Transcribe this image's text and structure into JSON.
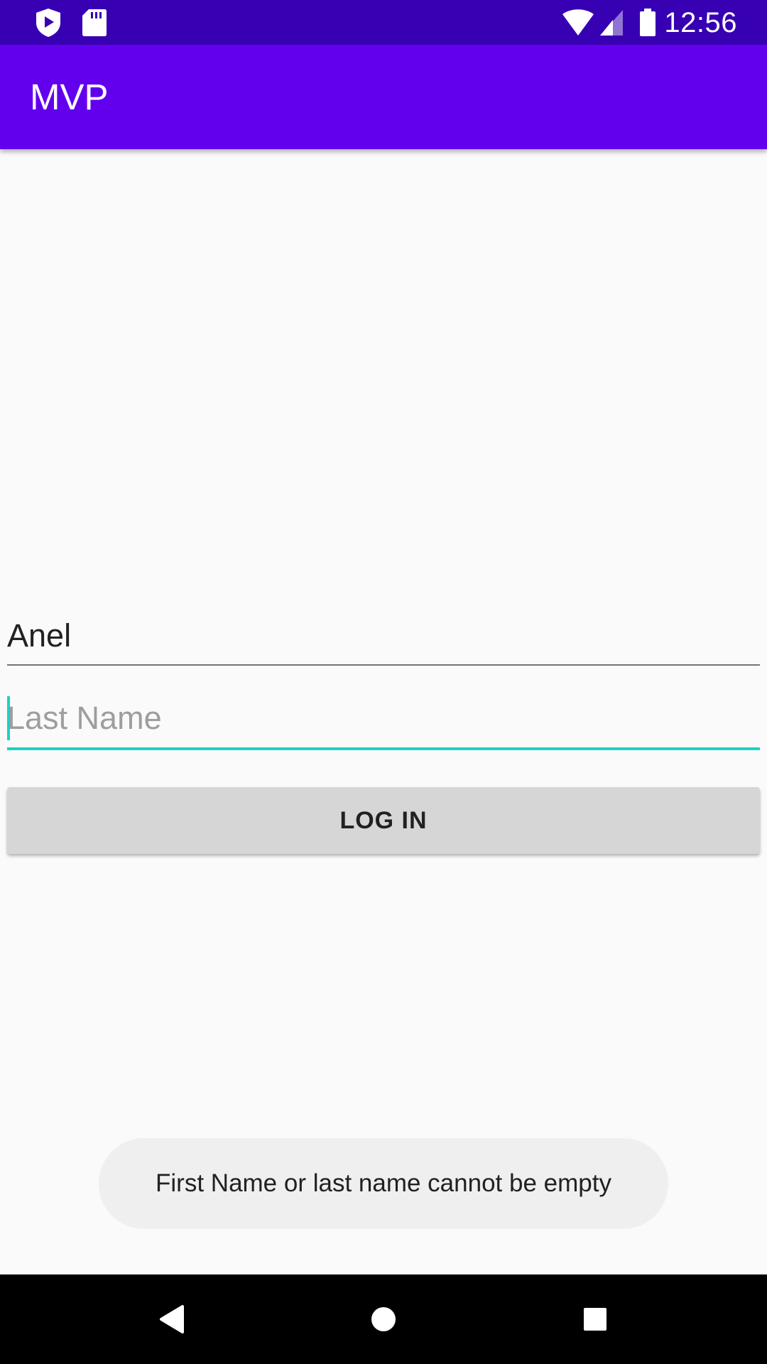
{
  "status_bar": {
    "time": "12:56",
    "left_icons": [
      "shield-play-icon",
      "sd-card-icon"
    ],
    "right_icons": [
      "wifi-icon",
      "cell-signal-icon",
      "battery-icon"
    ]
  },
  "app_bar": {
    "title": "MVP",
    "color": "#6200ee"
  },
  "form": {
    "first_name": {
      "value": "Anel"
    },
    "last_name": {
      "value": "",
      "placeholder": "Last Name",
      "focused": true,
      "accent_color": "#1ad3c3"
    },
    "login_button": {
      "label": "LOG IN"
    }
  },
  "toast": {
    "message": "First Name or last name cannot be empty"
  },
  "nav_bar": {
    "buttons": [
      "back-icon",
      "home-icon",
      "recents-icon"
    ]
  }
}
